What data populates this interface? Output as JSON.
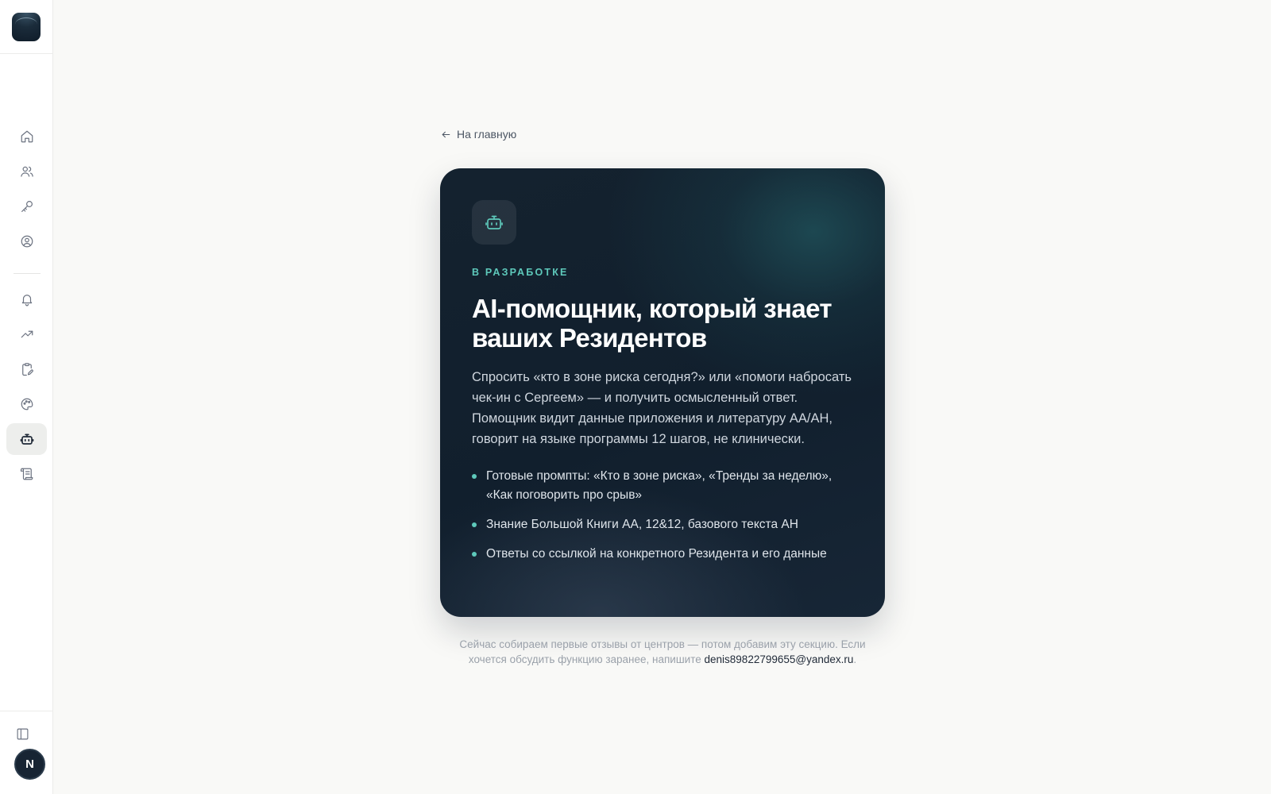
{
  "sidebar": {
    "logo_icon": "app-logo",
    "nav": [
      {
        "name": "home",
        "icon": "home-icon"
      },
      {
        "name": "residents",
        "icon": "users-icon"
      },
      {
        "name": "keys",
        "icon": "key-icon"
      },
      {
        "name": "profile",
        "icon": "user-circle-icon"
      },
      {
        "name": "notifications",
        "icon": "bell-icon"
      },
      {
        "name": "trends",
        "icon": "trending-up-icon"
      },
      {
        "name": "forms",
        "icon": "clipboard-edit-icon"
      },
      {
        "name": "palette",
        "icon": "palette-icon"
      },
      {
        "name": "ai-assistant",
        "icon": "bot-icon",
        "active": true
      },
      {
        "name": "scroll",
        "icon": "scroll-icon"
      }
    ],
    "panel_toggle_icon": "panel-left-icon",
    "avatar_letter": "N"
  },
  "main": {
    "back_link": "На главную",
    "card": {
      "icon": "bot-icon",
      "eyebrow": "В РАЗРАБОТКЕ",
      "title": "AI-помощник, который знает ваших Резидентов",
      "description": "Спросить «кто в зоне риска сегодня?» или «помоги набросать чек-ин с Сергеем» — и получить осмысленный ответ. Помощник видит данные приложения и литературу АА/АН, говорит на языке программы 12 шагов, не клинически.",
      "bullets": [
        "Готовые промпты: «Кто в зоне риска», «Тренды за неделю», «Как поговорить про срыв»",
        "Знание Большой Книги АА, 12&12, базового текста АН",
        "Ответы со ссылкой на конкретного Резидента и его данные"
      ]
    },
    "footnote": {
      "text": "Сейчас собираем первые отзывы от центров — потом добавим эту секцию. Если хочется обсудить функцию заранее, напишите ",
      "email": "denis89822799655@yandex.ru",
      "end": "."
    }
  },
  "colors": {
    "accent": "#5ec9bb",
    "card_bg": "#111f2d",
    "page_bg": "#f9f9f7"
  }
}
